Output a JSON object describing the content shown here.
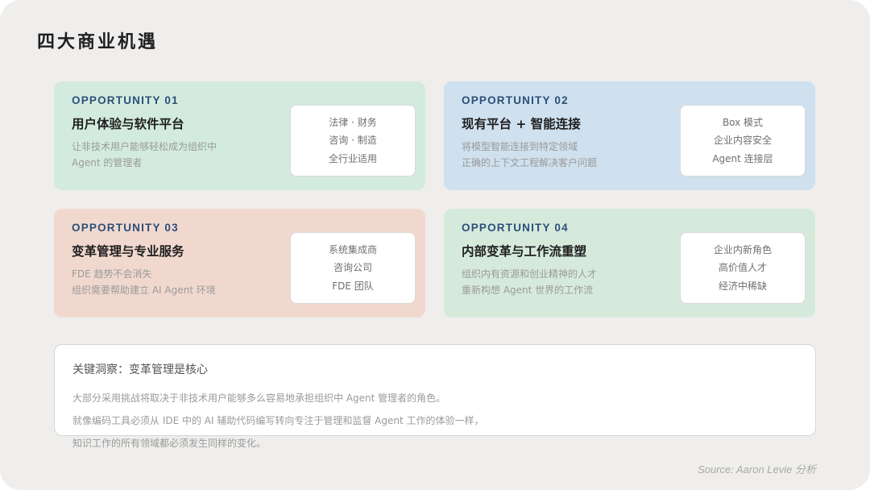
{
  "title": "四大商业机遇",
  "cards": [
    {
      "tag": "OPPORTUNITY 01",
      "heading": "用户体验与软件平台",
      "desc": [
        "让非技术用户能够轻松成为组织中",
        "Agent 的管理者"
      ],
      "tags": [
        "法律 · 财务",
        "咨询 · 制造",
        "全行业适用"
      ],
      "bg": "#d3ebdf"
    },
    {
      "tag": "OPPORTUNITY 02",
      "heading": "现有平台 + 智能连接",
      "desc": [
        "将模型智能连接到特定领域",
        "正确的上下文工程解决客户问题"
      ],
      "tags": [
        "Box 模式",
        "企业内容安全",
        "Agent 连接层"
      ],
      "bg": "#cfe0ef"
    },
    {
      "tag": "OPPORTUNITY 03",
      "heading": "变革管理与专业服务",
      "desc": [
        "FDE 趋势不会消失",
        "组织需要帮助建立 AI Agent 环境"
      ],
      "tags": [
        "系统集成商",
        "咨询公司",
        "FDE 团队"
      ],
      "bg": "#f1d8cf"
    },
    {
      "tag": "OPPORTUNITY 04",
      "heading": "内部变革与工作流重塑",
      "desc": [
        "组织内有资源和创业精神的人才",
        "重新构想 Agent 世界的工作流"
      ],
      "tags": [
        "企业内新角色",
        "高价值人才",
        "经济中稀缺"
      ],
      "bg": "#d6eadc"
    }
  ],
  "insight": {
    "title": "关键洞察：变革管理是核心",
    "lines": [
      "大部分采用挑战将取决于非技术用户能够多么容易地承担组织中 Agent 管理者的角色。",
      "就像编码工具必须从 IDE 中的 AI 辅助代码编写转向专注于管理和监督 Agent 工作的体验一样，",
      "知识工作的所有领域都必须发生同样的变化。"
    ]
  },
  "source": "Source: Aaron Levie 分析",
  "colors": {
    "accent": "#2c4f78",
    "background": "#efeeec"
  }
}
